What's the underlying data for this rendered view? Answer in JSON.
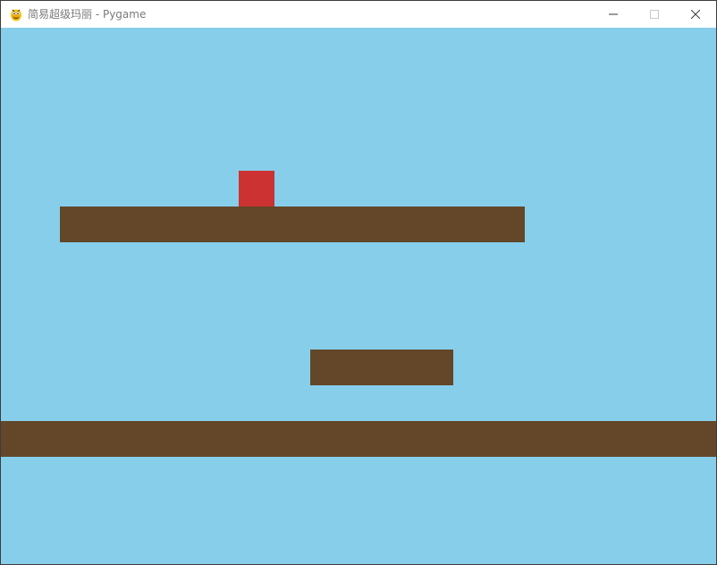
{
  "window": {
    "title": "简易超级玛丽 - Pygame",
    "icon": "pygame-snake-icon",
    "controls": {
      "minimize_icon": "minimize-icon",
      "maximize_icon": "maximize-icon",
      "close_icon": "close-icon"
    }
  },
  "game": {
    "colors": {
      "sky": "#87ceeb",
      "platform": "#634728",
      "player": "#cd3232"
    },
    "objects": {
      "platforms": [
        "upper-platform",
        "middle-platform",
        "ground"
      ],
      "player": "player-block"
    }
  }
}
